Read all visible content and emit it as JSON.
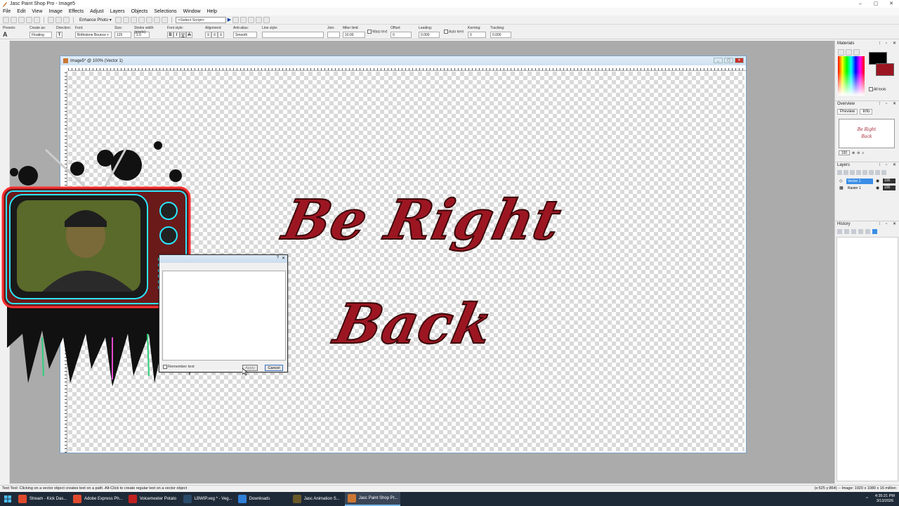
{
  "window": {
    "title": "Jasc Paint Shop Pro - Image5",
    "controls": [
      "–",
      "▢",
      "✕"
    ]
  },
  "menu": [
    "File",
    "Edit",
    "View",
    "Image",
    "Effects",
    "Adjust",
    "Layers",
    "Objects",
    "Selections",
    "Window",
    "Help"
  ],
  "toolbar": {
    "enhance_label": "Enhance Photo ▾",
    "script_select": "<Select Script>"
  },
  "tool_options": {
    "presets_label": "Presets:",
    "create_as_label": "Create as:",
    "create_as_value": "Floating",
    "direction_label": "Direction:",
    "font_label": "Font:",
    "font_value": "Brithstone Bounce +",
    "size_label": "Size:",
    "size_value": "125",
    "stroke_label": "Stroke width (pixels):",
    "stroke_value": "2.0",
    "font_style_label": "Font style:",
    "bold": "B",
    "italic": "I",
    "underline": "U",
    "strike": "A",
    "alignment_label": "Alignment:",
    "antialias_label": "Anti-alias:",
    "antialias_value": "Smooth",
    "line_style_label": "Line style:",
    "join_label": "Join:",
    "miter_label": "Miter limit:",
    "miter_value": "10.00",
    "warp_label": "Warp text",
    "offset_label": "Offset:",
    "offset_value": "0",
    "leading_label": "Leading:",
    "leading_value": "0.000",
    "auto_kern_label": "Auto kern",
    "kerning_label": "Kerning:",
    "kerning_value": "0",
    "tracking_label": "Tracking:",
    "tracking_value": "0.000"
  },
  "image_window": {
    "title": "Image5* @ 100% (Vector 1)",
    "controls": [
      "_",
      "▢",
      "✕"
    ]
  },
  "canvas_text": {
    "line1": "Be Right",
    "line2": "Back"
  },
  "text_dialog": {
    "remember_label": "Remember text",
    "apply_label": "Apply",
    "cancel_label": "Cancel"
  },
  "palettes": {
    "materials": {
      "title": "Materials",
      "all_tools": "All tools"
    },
    "overview": {
      "title": "Overview",
      "tab_preview": "Preview",
      "tab_info": "Info",
      "zoom": "100",
      "thumb_line1": "Be Right",
      "thumb_line2": "Back"
    },
    "layers": {
      "title": "Layers",
      "items": [
        {
          "name": "Vector 1",
          "opacity": "100"
        },
        {
          "name": "Raster 1",
          "opacity": "100"
        }
      ]
    },
    "history": {
      "title": "History"
    }
  },
  "status": {
    "hint": "Text Tool: Clicking on a vector object creates text on a path. Alt-Click to create regular text on a vector object",
    "info": "(x:525 y:864) -- Image:  1920 x 1080 x 16 million"
  },
  "taskbar": {
    "items": [
      {
        "label": "Stream - Kick Das...",
        "color": "#e04a2c"
      },
      {
        "label": "Adobe Express Ph...",
        "color": "#e04a2c"
      },
      {
        "label": "Voicemeeter Potato",
        "color": "#c02020"
      },
      {
        "label": "LBWIP.veg * - Veg...",
        "color": "#2a4a6a"
      },
      {
        "label": "Downloads",
        "color": "#2f7fd8"
      },
      {
        "label": "Jasc Animation S...",
        "color": "#6a5a2a"
      },
      {
        "label": "Jasc Paint Shop Pr...",
        "color": "#c73"
      }
    ],
    "time": "4:35:21 PM",
    "date": "3/13/2026",
    "tray_up": "^"
  },
  "colors": {
    "accent": "#9c1622",
    "outline": "#3a0508",
    "taskbar": "#1f2a38"
  }
}
